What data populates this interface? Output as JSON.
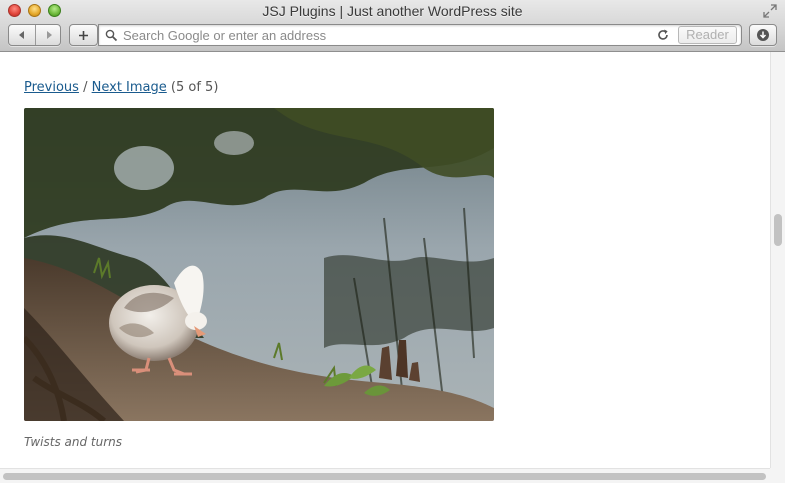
{
  "window": {
    "title": "JSJ Plugins | Just another WordPress site"
  },
  "toolbar": {
    "address_placeholder": "Search Google or enter an address",
    "address_value": "",
    "reader_label": "Reader"
  },
  "page": {
    "previous_label": "Previous",
    "separator": "/",
    "next_label": "Next Image",
    "counter": "(5 of 5)",
    "caption": "Twists and turns"
  },
  "colors": {
    "link": "#1a5b8e",
    "traffic_close": "#e0443a",
    "traffic_minimize": "#e5a82a",
    "traffic_maximize": "#6cb83a"
  },
  "icons": {
    "back": "back-arrow-icon",
    "forward": "forward-arrow-icon",
    "add": "plus-icon",
    "search": "magnifier-icon",
    "reload": "reload-icon",
    "downloads": "download-icon",
    "fullscreen": "fullscreen-icon"
  }
}
